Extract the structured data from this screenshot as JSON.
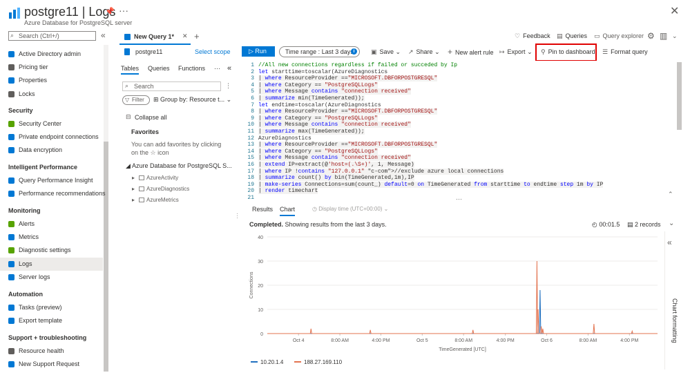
{
  "header": {
    "title": "postgre11 | Logs",
    "subtitle": "Azure Database for PostgreSQL server"
  },
  "sidebar": {
    "search_placeholder": "Search (Ctrl+/)",
    "items_top": [
      {
        "label": "Active Directory admin",
        "color": "#0078d4"
      },
      {
        "label": "Pricing tier",
        "color": "#605e5c"
      },
      {
        "label": "Properties",
        "color": "#0078d4"
      },
      {
        "label": "Locks",
        "color": "#605e5c"
      }
    ],
    "sections": [
      {
        "title": "Security",
        "items": [
          {
            "label": "Security Center",
            "color": "#57a300"
          },
          {
            "label": "Private endpoint connections",
            "color": "#0078d4"
          },
          {
            "label": "Data encryption",
            "color": "#0078d4"
          }
        ]
      },
      {
        "title": "Intelligent Performance",
        "items": [
          {
            "label": "Query Performance Insight",
            "color": "#0078d4"
          },
          {
            "label": "Performance recommendations",
            "color": "#0078d4"
          }
        ]
      },
      {
        "title": "Monitoring",
        "items": [
          {
            "label": "Alerts",
            "color": "#57a300"
          },
          {
            "label": "Metrics",
            "color": "#0078d4"
          },
          {
            "label": "Diagnostic settings",
            "color": "#57a300"
          },
          {
            "label": "Logs",
            "color": "#0078d4",
            "selected": true
          },
          {
            "label": "Server logs",
            "color": "#0078d4"
          }
        ]
      },
      {
        "title": "Automation",
        "items": [
          {
            "label": "Tasks (preview)",
            "color": "#0078d4"
          },
          {
            "label": "Export template",
            "color": "#0078d4"
          }
        ]
      },
      {
        "title": "Support + troubleshooting",
        "items": [
          {
            "label": "Resource health",
            "color": "#605e5c"
          },
          {
            "label": "New Support Request",
            "color": "#0078d4"
          }
        ]
      }
    ]
  },
  "tab": {
    "label": "New Query 1*"
  },
  "top_right": {
    "feedback": "Feedback",
    "queries": "Queries",
    "query_explorer": "Query explorer"
  },
  "scope": {
    "name": "postgre11",
    "select": "Select scope"
  },
  "toolbar": {
    "run": "Run",
    "time_range_label": "Time range :",
    "time_range_value": "Last 3 days",
    "save": "Save",
    "share": "Share",
    "new_alert": "New alert rule",
    "export": "Export",
    "pin": "Pin to dashboard",
    "format": "Format query"
  },
  "pane": {
    "tabs": [
      "Tables",
      "Queries",
      "Functions"
    ],
    "search_placeholder": "Search",
    "filter": "Filter",
    "group_by": "Group by: Resource t...",
    "collapse_all": "Collapse all",
    "favorites_title": "Favorites",
    "favorites_text": "You can add favorites by clicking on the ☆ icon",
    "db_node": "Azure Database for PostgreSQL S...",
    "tables": [
      "AzureActivity",
      "AzureDiagnostics",
      "AzureMetrics"
    ]
  },
  "editor": {
    "lines": [
      "//All new connections regardless if failed or succeded by Ip",
      "let starttime=toscalar(AzureDiagnostics",
      "| where ResourceProvider ==\"MICROSOFT.DBFORPOSTGRESQL\"",
      "| where Category == \"PostgreSQLLogs\"",
      "| where Message contains \"connection received\"",
      "| summarize min(TimeGenerated));",
      "let endtime=toscalar(AzureDiagnostics",
      "| where ResourceProvider ==\"MICROSOFT.DBFORPOSTGRESQL\"",
      "| where Category == \"PostgreSQLLogs\"",
      "| where Message contains \"connection received\"",
      "| summarize max(TimeGenerated));",
      "AzureDiagnostics",
      "| where ResourceProvider ==\"MICROSOFT.DBFORPOSTGRESQL\"",
      "| where Category == \"PostgreSQLLogs\"",
      "| where Message contains \"connection received\"",
      "| extend IP=extract(@'host=(.\\S+)', 1, Message)",
      "| where IP !contains \"127.0.0.1\" //exclude azure local connections",
      "| summarize count() by bin(TimeGenerated,1m),IP",
      "| make-series Connections=sum(count_) default=0 on TimeGenerated from starttime to endtime step 1m by IP",
      "| render timechart"
    ]
  },
  "results": {
    "tabs": [
      "Results",
      "Chart"
    ],
    "display_time": "Display time (UTC+00:00)",
    "status_bold": "Completed.",
    "status_text": "Showing results from the last 3 days.",
    "duration": "00:01.5",
    "records": "2 records",
    "chart_formatting": "Chart formatting"
  },
  "chart_data": {
    "type": "line",
    "xlabel": "TimeGenerated [UTC]",
    "ylabel": "Connections",
    "ylim": [
      0,
      40
    ],
    "yticks": [
      0,
      10,
      20,
      30,
      40
    ],
    "xticks": [
      "Oct 4",
      "8:00 AM",
      "4:00 PM",
      "Oct 5",
      "8:00 AM",
      "4:00 PM",
      "Oct 6",
      "8:00 AM",
      "4:00 PM"
    ],
    "series": [
      {
        "name": "10.20.1.4",
        "color": "#1f6fbf",
        "spikes": [
          {
            "t": 0.699,
            "v": 18
          }
        ]
      },
      {
        "name": "188.27.169.110",
        "color": "#e3734f",
        "spikes": [
          {
            "t": 0.112,
            "v": 2
          },
          {
            "t": 0.264,
            "v": 1.5
          },
          {
            "t": 0.527,
            "v": 1.5
          },
          {
            "t": 0.691,
            "v": 30
          },
          {
            "t": 0.694,
            "v": 10
          },
          {
            "t": 0.702,
            "v": 3
          },
          {
            "t": 0.706,
            "v": 2
          },
          {
            "t": 0.837,
            "v": 4
          },
          {
            "t": 0.935,
            "v": 1
          }
        ]
      }
    ],
    "legend_position": "bottom-left",
    "grid": true
  }
}
